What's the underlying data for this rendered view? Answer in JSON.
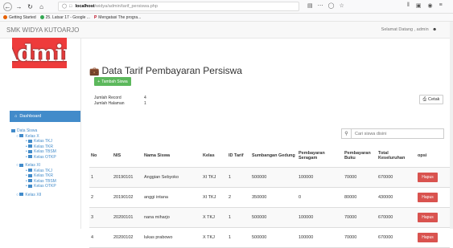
{
  "browser": {
    "url_host": "localhost",
    "url_path": "/widya/admin/tarif_persiswa.php",
    "bookmarks": [
      "Getting Started",
      "25. Latsar 17 - Google ...",
      "Mengatasi The progra..."
    ]
  },
  "topnav": {
    "brand": "SMK WIDYA KUTOARJO",
    "greeting": "Selamat Datang , admin"
  },
  "sidebar": {
    "logo_text": "Admin",
    "dashboard_label": "Dashboard",
    "data_siswa_label": "Data Siswa",
    "groups": [
      {
        "label": "Kelas X",
        "items": [
          "Kelas TKJ",
          "Kelas TKR",
          "Kelas TBSM",
          "Kelas OTKP"
        ]
      },
      {
        "label": "Kelas XI",
        "items": [
          "Kelas TKJ",
          "Kelas TKR",
          "Kelas TBSM",
          "Kelas OTKP"
        ]
      },
      {
        "label": "Kelas XII",
        "items": []
      }
    ]
  },
  "main": {
    "title": "Data Tarif Pembayaran Persiswa",
    "tambah_label": "Tambah Siswa",
    "jumlah_record_label": "Jumlah Record",
    "jumlah_record_value": "4",
    "jumlah_halaman_label": "Jumlah Halaman",
    "jumlah_halaman_value": "1",
    "cetak_label": "Cetak",
    "search_placeholder": "Cari siswa disini"
  },
  "table": {
    "headers": [
      "No",
      "NIS",
      "Nama Siswa",
      "Kelas",
      "ID Tarif",
      "Sumbangan Gedung",
      "Pembayaran Seragam",
      "Pembayaran Buku",
      "Total Keseluruhan",
      "opsi"
    ],
    "rows": [
      [
        "1",
        "20190101",
        "Anggian Sebyoko",
        "XI TKJ",
        "1",
        "500000",
        "100000",
        "70000",
        "670000",
        "Hapus"
      ],
      [
        "2",
        "20190102",
        "anggi intana",
        "XI TKJ",
        "2",
        "350000",
        "0",
        "80000",
        "430000",
        "Hapus"
      ],
      [
        "3",
        "20200101",
        "nana miharjo",
        "X TKJ",
        "1",
        "500000",
        "100000",
        "70000",
        "670000",
        "Hapus"
      ],
      [
        "4",
        "20200102",
        "lukas prabowo",
        "X TKJ",
        "1",
        "500000",
        "100000",
        "70000",
        "670000",
        "Hapus"
      ]
    ]
  },
  "colors": {
    "primary": "#428bca",
    "success": "#5cb85c",
    "danger": "#d9534f",
    "logo_bg": "#ee3b3b"
  }
}
